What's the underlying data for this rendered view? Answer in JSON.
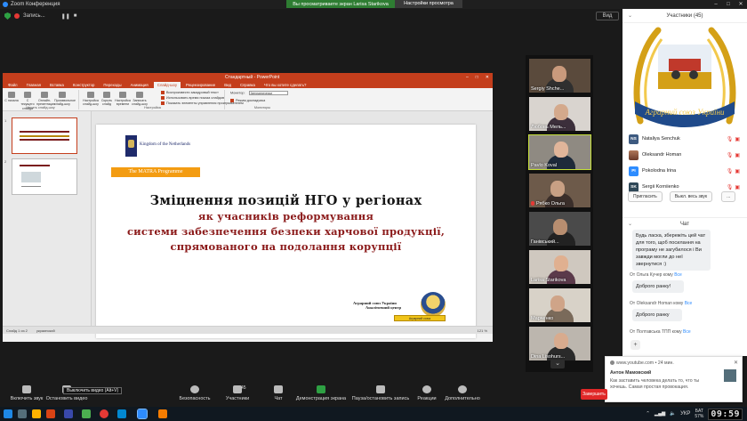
{
  "app": {
    "title": "Zoom Конференция",
    "window_controls": [
      "–",
      "□",
      "✕"
    ]
  },
  "share_banner": {
    "message": "Вы просматриваете экран Larisa Starikova",
    "options_label": "Настройки просмотра"
  },
  "recording": {
    "label": "Запись...",
    "pause": "❚❚",
    "stop": "■"
  },
  "view_button": "Вид",
  "powerpoint": {
    "doc_title": "Стандартный - PowerPoint",
    "tabs": [
      "Файл",
      "Главная",
      "Вставка",
      "Конструктор",
      "Переходы",
      "Анимация",
      "Слайд-шоу",
      "Рецензирование",
      "Вид",
      "Справка",
      "Что вы хотите сделать?"
    ],
    "active_tab": "Слайд-шоу",
    "ribbon": {
      "buttons": [
        "С начала",
        "С текущего слайда",
        "Онлайн-презентация",
        "Произвольное слайд-шоу",
        "Настройка слайд-шоу",
        "Скрыть слайд",
        "Настройка времени",
        "Записать слайд-шоу"
      ],
      "groups": [
        "Начать слайд-шоу",
        "Настройка",
        "Мониторы"
      ],
      "checks": [
        {
          "label": "Воспроизвести закадровый текст",
          "on": true
        },
        {
          "label": "Использовать время показа слайдов",
          "on": true
        },
        {
          "label": "Показать элементы управления проигрывателем",
          "on": true
        }
      ],
      "monitor_label": "Монитор:",
      "monitor_value": "Автоматически",
      "presenter_mode": "Режим докладчика"
    },
    "thumbs": [
      "1",
      "2"
    ],
    "status_left": "Слайд 1 из 2",
    "status_lang": "украинский",
    "status_zoom": "121 %"
  },
  "slide": {
    "nl_text": "Kingdom of the Netherlands",
    "matra": "The MATRA Programme",
    "title_line1": "Зміцнення позицій НГО у регіонах",
    "title_lines": [
      "як учасників реформування",
      "системи забезпечення безпеки харчової продукції,",
      "спрямованого на подолання корупції"
    ],
    "logo_text_1": "Аграрний союз України",
    "logo_text_2": "Аналітичний центр",
    "logo_ribbon": "Аграрний союз"
  },
  "gallery": [
    {
      "name": "Sergiy Shche...",
      "muted": false
    },
    {
      "name": "Любовь Мель...",
      "muted": false
    },
    {
      "name": "Pavlo Koval",
      "muted": false,
      "active": true
    },
    {
      "name": "Рябко Ольга",
      "muted": true
    },
    {
      "name": "Ганівський...",
      "muted": false
    },
    {
      "name": "Larisa Starikova",
      "muted": false
    },
    {
      "name": "Марченко",
      "muted": false
    },
    {
      "name": "Dina Lisohurs...",
      "muted": false
    }
  ],
  "participants": {
    "header": "Участники (45)",
    "emblem_text": "Аграрний союз України",
    "list": [
      {
        "initials": "NS",
        "name": "Nataliya Senchuk",
        "kind": "ns"
      },
      {
        "initials": "",
        "name": "Oleksandr Homan",
        "kind": "photo"
      },
      {
        "initials": "PI",
        "name": "Pokolodna Irina",
        "kind": "pi"
      },
      {
        "initials": "SK",
        "name": "Sergii Korniienko",
        "kind": "sk"
      }
    ],
    "buttons": [
      "Пригласить",
      "Выкл. весь звук",
      "..."
    ]
  },
  "chat": {
    "header": "Чат",
    "messages": [
      {
        "meta_from": "",
        "meta_to": "",
        "text": "Будь ласка, збережіть цей чат для того, щоб посилання на програму не загубилося і Ви завжди могли до неї звернутися :)"
      },
      {
        "meta_from": "От Ольга Кучер",
        "meta_to": "Все",
        "text": "Доброго ранку!"
      },
      {
        "meta_from": "От Oleksandr Homan",
        "meta_to": "Все",
        "text": "Доброго ранку"
      },
      {
        "meta_from": "От Полтавська ТПП",
        "meta_to": "Все",
        "text": ""
      }
    ],
    "to_word": "кому",
    "emoji": "+"
  },
  "notification": {
    "site": "www.youtube.com",
    "age": "• 24 мин.",
    "author": "Антон Мамовский",
    "text": "Как заставить человека делать то, что ты хочешь. Самая простая провокация.",
    "close": "✕"
  },
  "toolbar": {
    "items": [
      {
        "label": "Включить звук"
      },
      {
        "label": "Остановить видео"
      },
      {
        "label": "Безопасность"
      },
      {
        "label": "Участники",
        "count": "45"
      },
      {
        "label": "Чат"
      },
      {
        "label": "Демонстрация экрана"
      },
      {
        "label": "Пауза/остановить запись"
      },
      {
        "label": "Реакции"
      },
      {
        "label": "Дополнительно"
      }
    ],
    "tooltip": "Выключить видео (Alt+V)",
    "end": "Завершить"
  },
  "taskbar": {
    "lang": "УКР",
    "battery": "57%",
    "battery_label": "БАТ",
    "clock": "09:59",
    "colors": [
      "#1e88e5",
      "#2e7d32",
      "#ffb300",
      "#e53935",
      "#0288d1",
      "#6a1b9a",
      "#00897b",
      "#2d8cff",
      "#f57c00"
    ]
  }
}
